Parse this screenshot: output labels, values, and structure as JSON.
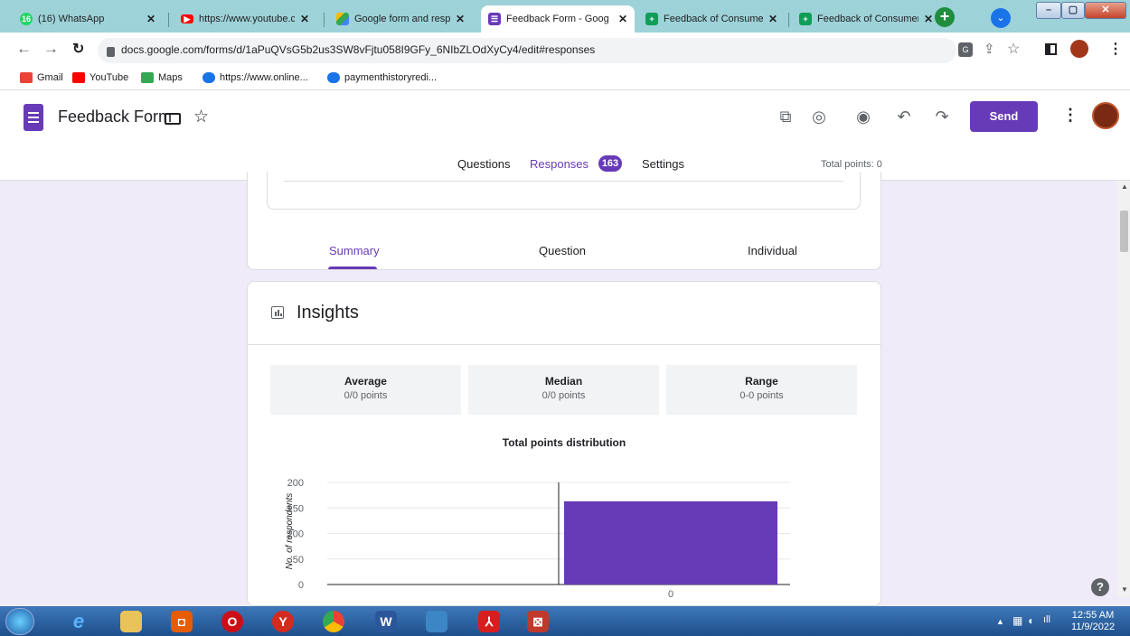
{
  "browser": {
    "tabs": [
      {
        "title": "(16) WhatsApp",
        "icon": "whatsapp-icon",
        "color": "#25d366",
        "badge": "16"
      },
      {
        "title": "https://www.youtube.co",
        "icon": "youtube-icon",
        "color": "#ff0000"
      },
      {
        "title": "Google form and respo",
        "icon": "drive-icon",
        "color": "#fbbc04"
      },
      {
        "title": "Feedback Form - Goog",
        "icon": "forms-icon",
        "color": "#673ab7",
        "active": true
      },
      {
        "title": "Feedback of Consumer",
        "icon": "sheets-icon",
        "color": "#0f9d58"
      },
      {
        "title": "Feedback of Consumer",
        "icon": "sheets-icon",
        "color": "#0f9d58"
      }
    ],
    "close_glyph": "✕",
    "new_tab": "+",
    "url": "docs.google.com/forms/d/1aPuQVsG5b2us3SW8vFjtu058I9GFy_6NIbZLOdXyCy4/edit#responses",
    "bookmarks": [
      {
        "label": "Gmail",
        "color": "#ea4335"
      },
      {
        "label": "YouTube",
        "color": "#ff0000"
      },
      {
        "label": "Maps",
        "color": "#34a853"
      },
      {
        "label": "https://www.online...",
        "color": "#1a73e8"
      },
      {
        "label": "paymenthistoryredi...",
        "color": "#1a73e8"
      }
    ]
  },
  "form": {
    "title": "Feedback Form",
    "send_label": "Send",
    "tabs": {
      "questions": "Questions",
      "responses": "Responses",
      "responses_count": "163",
      "settings": "Settings"
    },
    "total_points": "Total points: 0",
    "subtabs": [
      "Summary",
      "Question",
      "Individual"
    ],
    "insights": {
      "title": "Insights",
      "stats": [
        {
          "label": "Average",
          "value": "0/0 points"
        },
        {
          "label": "Median",
          "value": "0/0 points"
        },
        {
          "label": "Range",
          "value": "0-0 points"
        }
      ]
    }
  },
  "chart_data": {
    "type": "bar",
    "title": "Total points distribution",
    "ylabel": "No. of respondents",
    "xlabel": "",
    "categories": [
      "0"
    ],
    "values": [
      163
    ],
    "ylim": [
      0,
      200
    ],
    "yticks": [
      0,
      50,
      100,
      150,
      200
    ],
    "color": "#673ab7",
    "grid": true
  },
  "taskbar": {
    "time": "12:55 AM",
    "date": "11/9/2022"
  },
  "accent": "#673ab7"
}
